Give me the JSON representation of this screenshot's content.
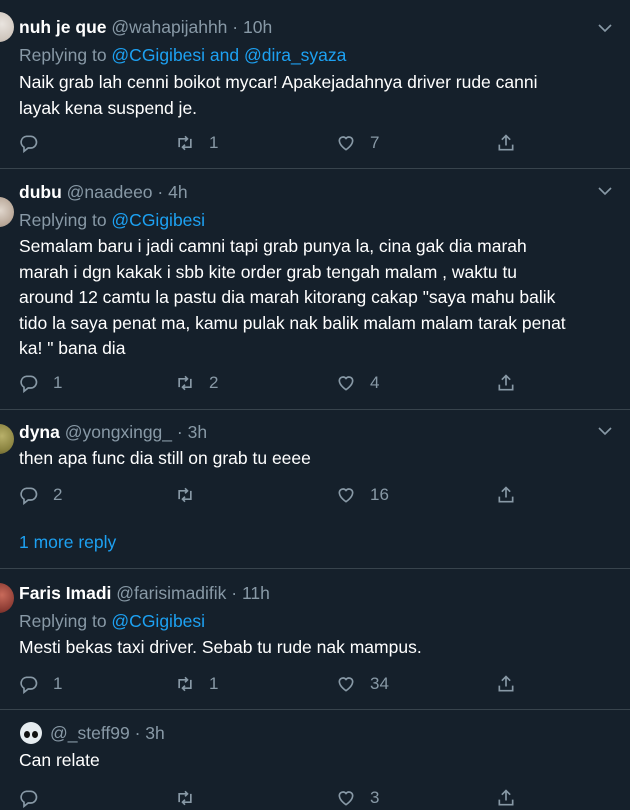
{
  "tweets": [
    {
      "name": "nuh je que",
      "handle": "@wahapijahhh",
      "sep": " · ",
      "time": "10h",
      "replying_prefix": "Replying to ",
      "replying_users": [
        "@CGigibesi",
        "@dira_syaza"
      ],
      "replying_joiner": " and ",
      "lines": [
        "Naik grab lah cenni boikot mycar! Apakejadahnya driver rude canni",
        "layak kena suspend je."
      ],
      "replies": "",
      "retweets": "1",
      "likes": "7"
    },
    {
      "name": "dubu",
      "handle": "@naadeeo",
      "sep": " · ",
      "time": "4h",
      "replying_prefix": "Replying to ",
      "replying_users": [
        "@CGigibesi"
      ],
      "lines": [
        "Semalam baru i jadi camni tapi grab punya la, cina gak dia marah",
        "marah i dgn kakak i sbb kite order grab tengah malam , waktu tu",
        "around 12 camtu la pastu dia marah kitorang cakap \"saya mahu balik",
        "tido la saya penat ma, kamu pulak nak balik malam malam tarak penat",
        "ka! \" bana dia"
      ],
      "replies": "1",
      "retweets": "2",
      "likes": "4"
    },
    {
      "name": "dyna",
      "handle": "@yongxingg_",
      "sep": " · ",
      "time": "3h",
      "lines": [
        "then apa func dia still on grab tu eeee"
      ],
      "replies": "2",
      "retweets": "",
      "likes": "16"
    },
    {
      "name": "Faris Imadi",
      "handle": "@farisimadifik",
      "sep": " · ",
      "time": "11h",
      "replying_prefix": "Replying to ",
      "replying_users": [
        "@CGigibesi"
      ],
      "lines": [
        "Mesti bekas taxi driver. Sebab tu rude nak mampus."
      ],
      "replies": "1",
      "retweets": "1",
      "likes": "34"
    },
    {
      "name": "",
      "handle": "@_steff99",
      "sep": " · ",
      "time": "3h",
      "lines": [
        "Can relate"
      ],
      "replies": "",
      "retweets": "",
      "likes": "3"
    }
  ],
  "more_replies": "1 more reply",
  "icons": {
    "reply": "reply-icon",
    "retweet": "retweet-icon",
    "like": "heart-icon",
    "share": "share-icon",
    "more": "chevron-down-icon"
  },
  "colors": {
    "background": "#15202b",
    "link": "#1da1f2",
    "muted": "#8899a6",
    "divider": "#38444d"
  }
}
